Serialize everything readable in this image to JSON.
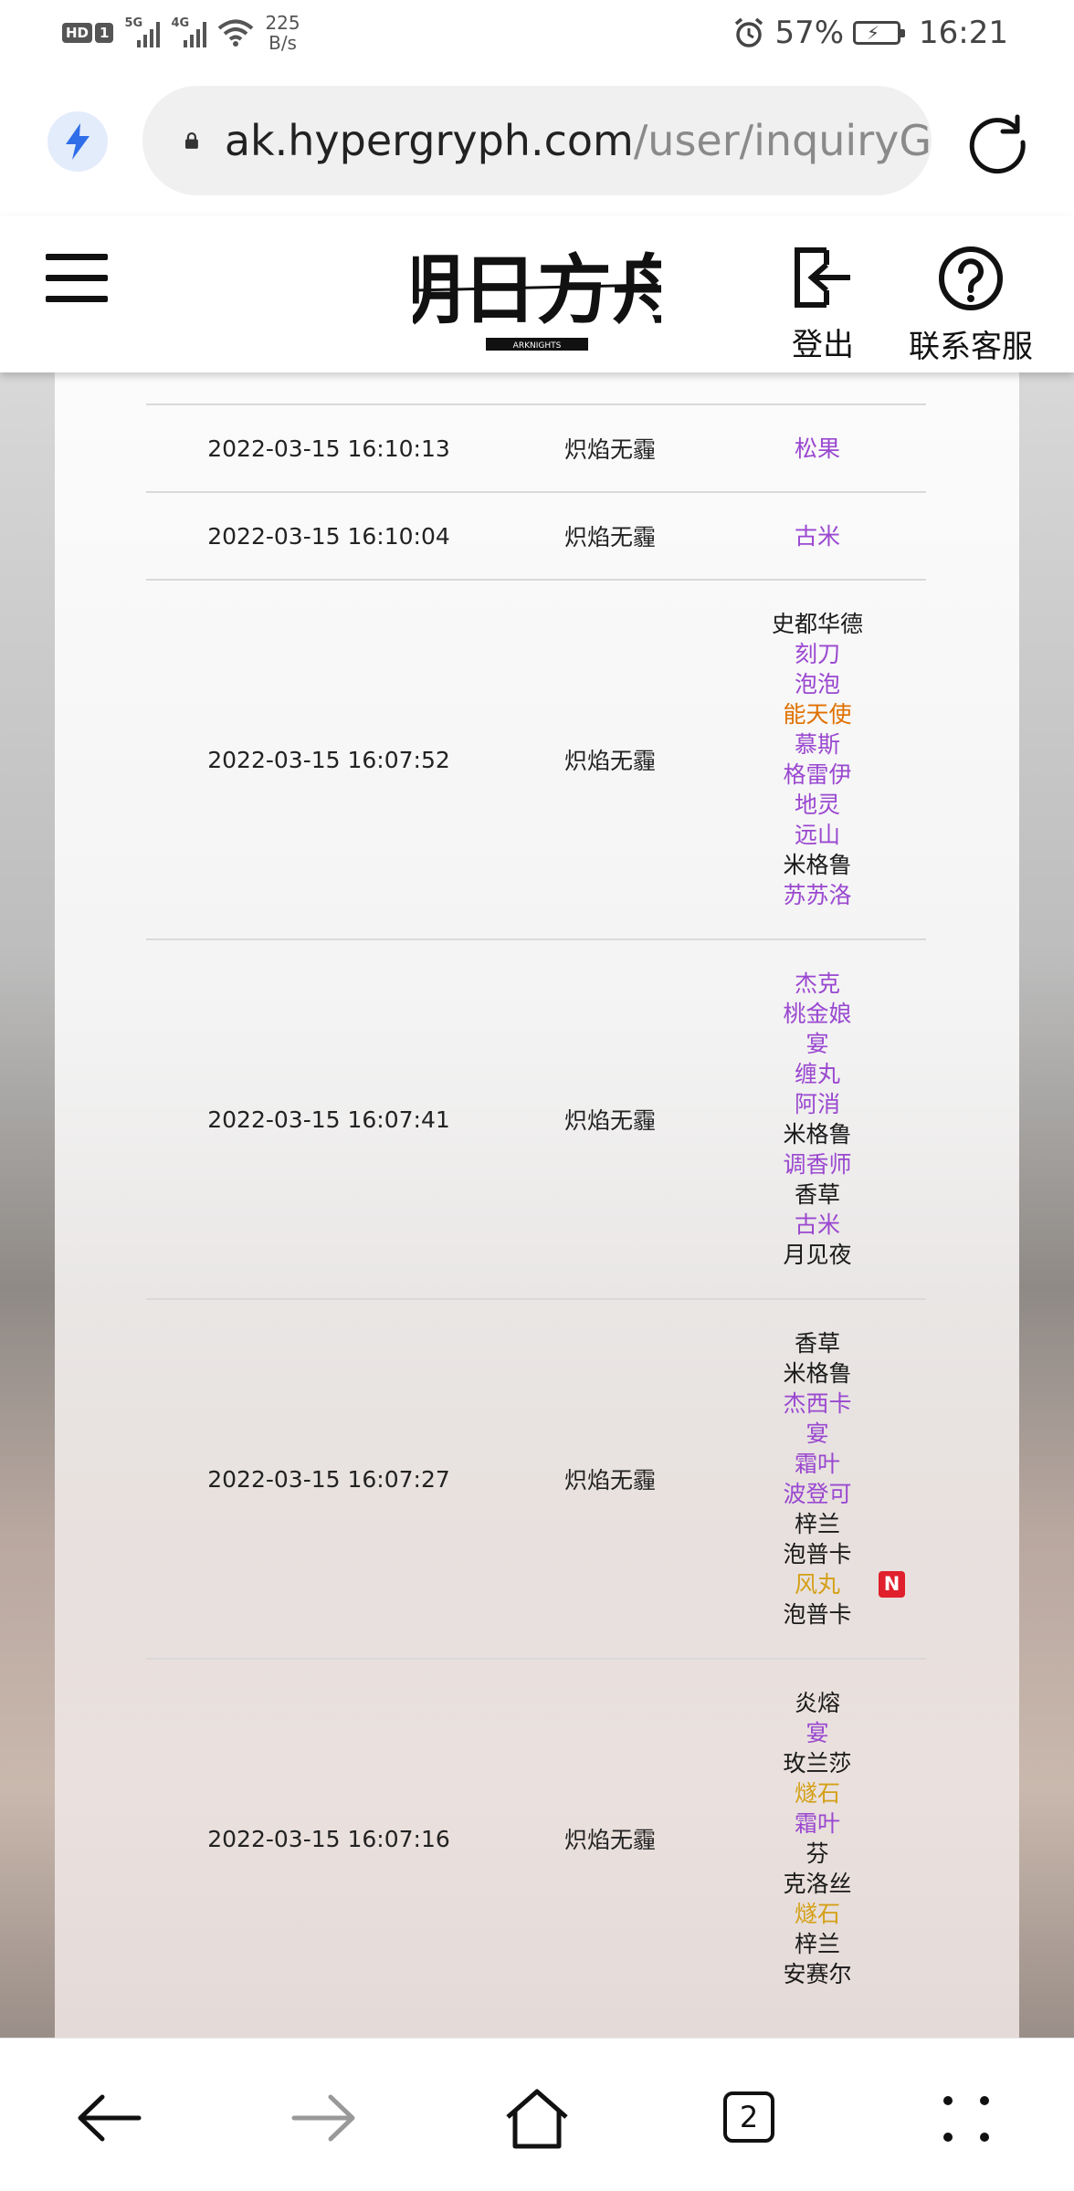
{
  "status_bar": {
    "hd": "HD",
    "sim": "1",
    "net1": "5G",
    "net2": "4G",
    "speed_value": "225",
    "speed_unit": "B/s",
    "battery": "57%",
    "time": "16:21"
  },
  "browser": {
    "url_host": "ak.hypergryph.com",
    "url_path": "/user/inquiryG",
    "tab_count": "2"
  },
  "site": {
    "logo_text": "明日方舟",
    "logo_sub": "ARKNIGHTS",
    "logout_label": "登出",
    "help_label": "联系客服"
  },
  "records": [
    {
      "time": "2022-03-15 16:10:13",
      "pool": "炽焰无霾",
      "ops": [
        {
          "name": "松果",
          "rarity": 4
        }
      ]
    },
    {
      "time": "2022-03-15 16:10:04",
      "pool": "炽焰无霾",
      "ops": [
        {
          "name": "古米",
          "rarity": 4
        }
      ]
    },
    {
      "time": "2022-03-15 16:07:52",
      "pool": "炽焰无霾",
      "ops": [
        {
          "name": "史都华德",
          "rarity": 3
        },
        {
          "name": "刻刀",
          "rarity": 4
        },
        {
          "name": "泡泡",
          "rarity": 4
        },
        {
          "name": "能天使",
          "rarity": 6
        },
        {
          "name": "慕斯",
          "rarity": 4
        },
        {
          "name": "格雷伊",
          "rarity": 4
        },
        {
          "name": "地灵",
          "rarity": 4
        },
        {
          "name": "远山",
          "rarity": 4
        },
        {
          "name": "米格鲁",
          "rarity": 3
        },
        {
          "name": "苏苏洛",
          "rarity": 4
        }
      ]
    },
    {
      "time": "2022-03-15 16:07:41",
      "pool": "炽焰无霾",
      "ops": [
        {
          "name": "杰克",
          "rarity": 4
        },
        {
          "name": "桃金娘",
          "rarity": 4
        },
        {
          "name": "宴",
          "rarity": 4
        },
        {
          "name": "缠丸",
          "rarity": 4
        },
        {
          "name": "阿消",
          "rarity": 4
        },
        {
          "name": "米格鲁",
          "rarity": 3
        },
        {
          "name": "调香师",
          "rarity": 4
        },
        {
          "name": "香草",
          "rarity": 3
        },
        {
          "name": "古米",
          "rarity": 4
        },
        {
          "name": "月见夜",
          "rarity": 3
        }
      ]
    },
    {
      "time": "2022-03-15 16:07:27",
      "pool": "炽焰无霾",
      "ops": [
        {
          "name": "香草",
          "rarity": 3
        },
        {
          "name": "米格鲁",
          "rarity": 3
        },
        {
          "name": "杰西卡",
          "rarity": 4
        },
        {
          "name": "宴",
          "rarity": 4
        },
        {
          "name": "霜叶",
          "rarity": 4
        },
        {
          "name": "波登可",
          "rarity": 4
        },
        {
          "name": "梓兰",
          "rarity": 3
        },
        {
          "name": "泡普卡",
          "rarity": 3
        },
        {
          "name": "风丸",
          "rarity": 5,
          "new": "N"
        },
        {
          "name": "泡普卡",
          "rarity": 3
        }
      ]
    },
    {
      "time": "2022-03-15 16:07:16",
      "pool": "炽焰无霾",
      "ops": [
        {
          "name": "炎熔",
          "rarity": 3
        },
        {
          "name": "宴",
          "rarity": 4
        },
        {
          "name": "玫兰莎",
          "rarity": 3
        },
        {
          "name": "燧石",
          "rarity": 5
        },
        {
          "name": "霜叶",
          "rarity": 4
        },
        {
          "name": "芬",
          "rarity": 3
        },
        {
          "name": "克洛丝",
          "rarity": 3
        },
        {
          "name": "燧石",
          "rarity": 5
        },
        {
          "name": "梓兰",
          "rarity": 3
        },
        {
          "name": "安赛尔",
          "rarity": 3
        }
      ]
    }
  ],
  "colors": {
    "rarity3": "#1a1a1a",
    "rarity4": "#9a48d0",
    "rarity5": "#d4a017",
    "rarity6": "#e07000",
    "new_badge": "#e0202c"
  }
}
